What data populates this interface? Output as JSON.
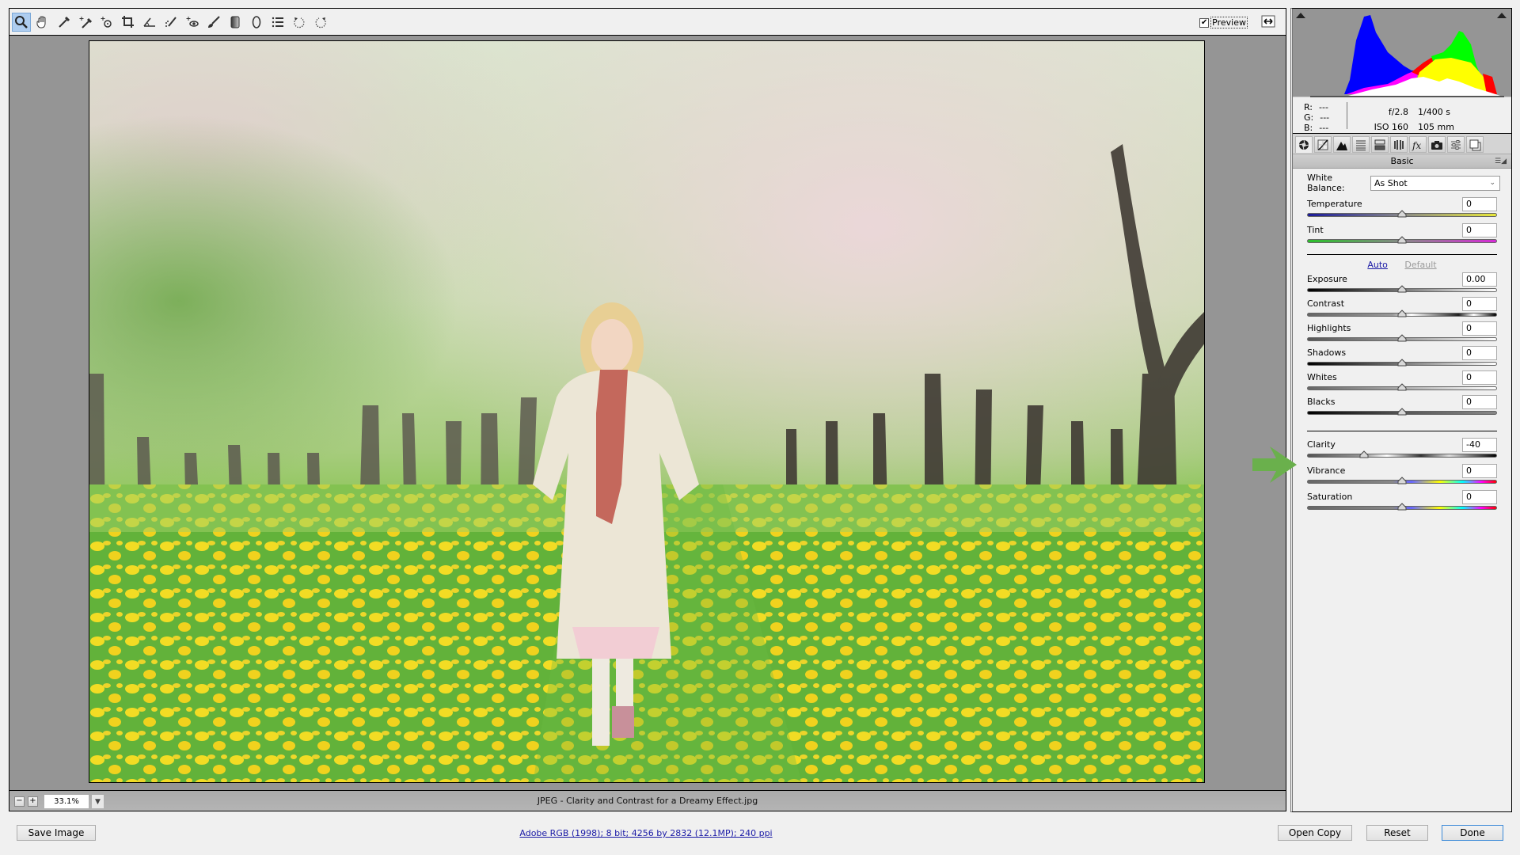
{
  "toolbar": {
    "tools": [
      {
        "name": "zoom-tool",
        "active": true
      },
      {
        "name": "hand-tool"
      },
      {
        "name": "white-balance-tool"
      },
      {
        "name": "color-sampler-tool"
      },
      {
        "name": "targeted-adjustment-tool"
      },
      {
        "name": "crop-tool"
      },
      {
        "name": "straighten-tool"
      },
      {
        "name": "spot-removal-tool"
      },
      {
        "name": "red-eye-removal-tool"
      },
      {
        "name": "adjustment-brush-tool"
      },
      {
        "name": "graduated-filter-tool"
      },
      {
        "name": "radial-filter-tool"
      },
      {
        "name": "preferences-tool"
      },
      {
        "name": "rotate-ccw-tool"
      },
      {
        "name": "rotate-cw-tool"
      }
    ],
    "preview_label": "Preview",
    "preview_checked": true
  },
  "statusbar": {
    "zoom_value": "33.1%",
    "filename": "JPEG  -  Clarity and Contrast for a Dreamy Effect.jpg"
  },
  "footer": {
    "save_label": "Save Image",
    "workflow_link": "Adobe RGB (1998); 8 bit; 4256 by 2832 (12.1MP); 240 ppi",
    "open_copy_label": "Open Copy",
    "reset_label": "Reset",
    "done_label": "Done"
  },
  "info": {
    "r_label": "R:",
    "r_value": "---",
    "g_label": "G:",
    "g_value": "---",
    "b_label": "B:",
    "b_value": "---",
    "aperture": "f/2.8",
    "shutter": "1/400 s",
    "iso": "ISO 160",
    "focal": "105 mm"
  },
  "panel": {
    "tabs": [
      "basic",
      "tone-curve",
      "detail",
      "hsl",
      "split-toning",
      "lens-corrections",
      "effects",
      "camera-calibration",
      "presets",
      "snapshots"
    ],
    "section_title": "Basic",
    "white_balance_label": "White Balance:",
    "white_balance_value": "As Shot",
    "auto_label": "Auto",
    "default_label": "Default",
    "sliders": {
      "temperature": {
        "label": "Temperature",
        "value": "0",
        "position": 0.5
      },
      "tint": {
        "label": "Tint",
        "value": "0",
        "position": 0.5
      },
      "exposure": {
        "label": "Exposure",
        "value": "0.00",
        "position": 0.5
      },
      "contrast": {
        "label": "Contrast",
        "value": "0",
        "position": 0.5
      },
      "highlights": {
        "label": "Highlights",
        "value": "0",
        "position": 0.5
      },
      "shadows": {
        "label": "Shadows",
        "value": "0",
        "position": 0.5
      },
      "whites": {
        "label": "Whites",
        "value": "0",
        "position": 0.5
      },
      "blacks": {
        "label": "Blacks",
        "value": "0",
        "position": 0.5
      },
      "clarity": {
        "label": "Clarity",
        "value": "-40",
        "position": 0.3
      },
      "vibrance": {
        "label": "Vibrance",
        "value": "0",
        "position": 0.5
      },
      "saturation": {
        "label": "Saturation",
        "value": "0",
        "position": 0.5
      }
    }
  },
  "colors": {
    "annotation_arrow": "#6ab04c",
    "link": "#1a1aa6",
    "canvas_bg": "#959595"
  }
}
